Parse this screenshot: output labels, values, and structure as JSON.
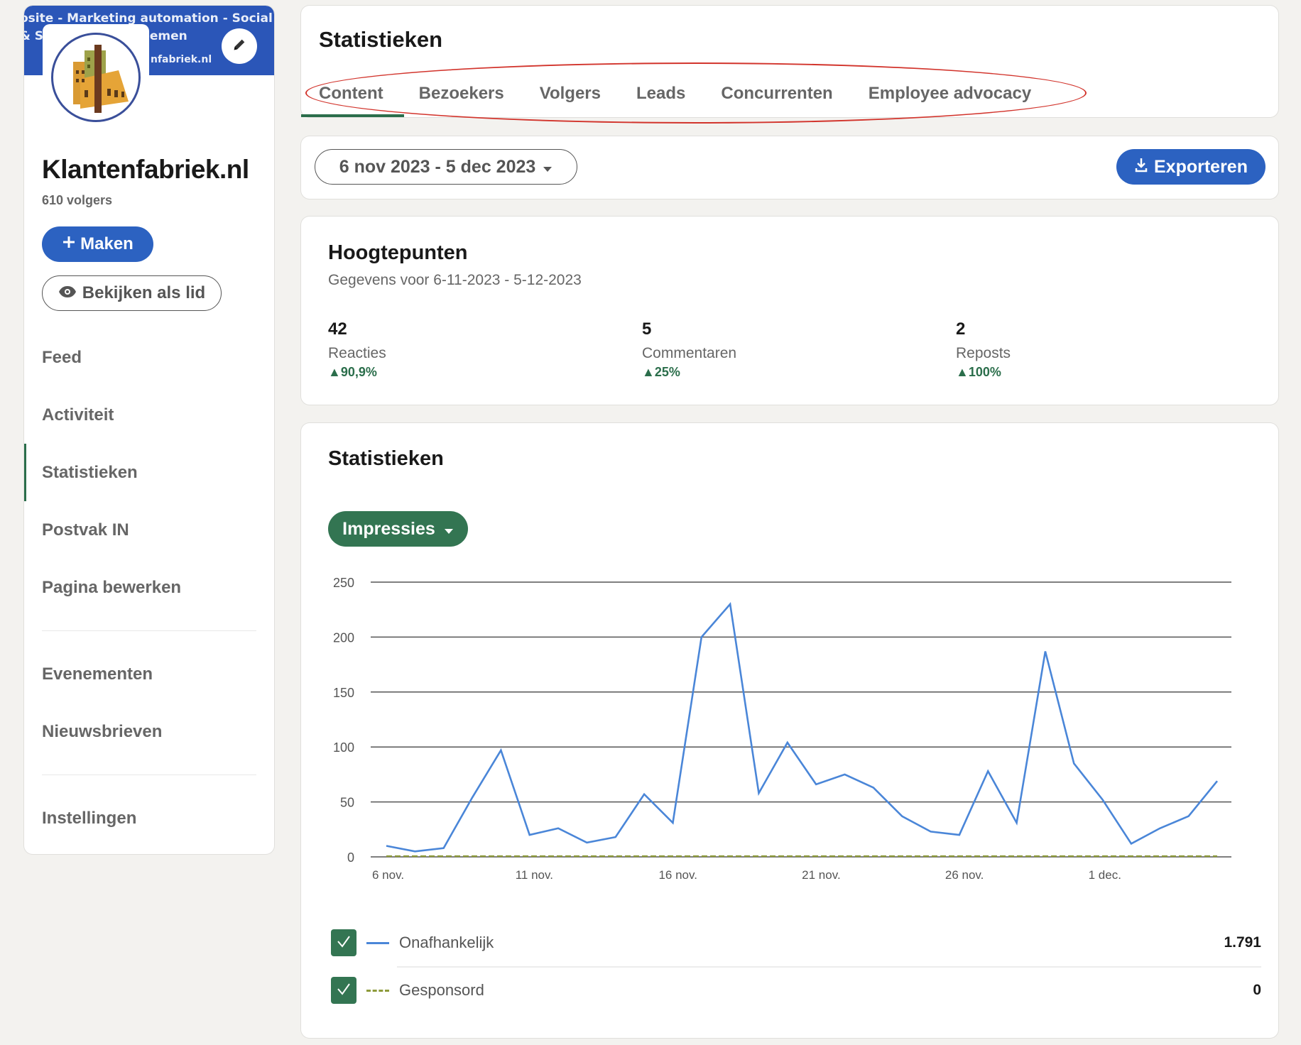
{
  "sidebar": {
    "banner_lines": [
      "osite - Marketing automation - Social med",
      "& S              rukwerk - Evenemen",
      "nfabriek.nl"
    ],
    "org_name": "Klantenfabriek.nl",
    "followers": "610 volgers",
    "make_label": "Maken",
    "view_as_member_label": "Bekijken als lid",
    "nav_primary": [
      {
        "label": "Feed",
        "active": false
      },
      {
        "label": "Activiteit",
        "active": false
      },
      {
        "label": "Statistieken",
        "active": true
      },
      {
        "label": "Postvak IN",
        "active": false
      },
      {
        "label": "Pagina bewerken",
        "active": false
      }
    ],
    "nav_secondary": [
      {
        "label": "Evenementen"
      },
      {
        "label": "Nieuwsbrieven"
      }
    ],
    "nav_tertiary": [
      {
        "label": "Instellingen"
      }
    ]
  },
  "header": {
    "title": "Statistieken",
    "tabs": [
      {
        "label": "Content",
        "active": true
      },
      {
        "label": "Bezoekers",
        "active": false
      },
      {
        "label": "Volgers",
        "active": false
      },
      {
        "label": "Leads",
        "active": false
      },
      {
        "label": "Concurrenten",
        "active": false
      },
      {
        "label": "Employee advocacy",
        "active": false
      }
    ]
  },
  "toolbar": {
    "date_range": "6 nov 2023 - 5 dec 2023",
    "export_label": "Exporteren"
  },
  "highlights": {
    "title": "Hoogtepunten",
    "subtitle": "Gegevens voor 6-11-2023 - 5-12-2023",
    "metrics": [
      {
        "value": "42",
        "label": "Reacties",
        "change": "90,9%"
      },
      {
        "value": "5",
        "label": "Commentaren",
        "change": "25%"
      },
      {
        "value": "2",
        "label": "Reposts",
        "change": "100%"
      }
    ]
  },
  "stats": {
    "title": "Statistieken",
    "metric_selected": "Impressies"
  },
  "colors": {
    "brand_blue": "#2c62c1",
    "brand_green": "#337552",
    "active_green": "#2b6e4b",
    "series_organic": "#4a86d8",
    "series_sponsored": "#8d9a3a",
    "annotation_red": "#d2342c"
  },
  "chart_data": {
    "type": "line",
    "title": "Statistieken",
    "xlabel": "",
    "ylabel": "",
    "ylim": [
      0,
      250
    ],
    "yticks": [
      0,
      50,
      100,
      150,
      200,
      250
    ],
    "grid": true,
    "x": [
      "6 nov.",
      "7 nov.",
      "8 nov.",
      "9 nov.",
      "10 nov.",
      "11 nov.",
      "12 nov.",
      "13 nov.",
      "14 nov.",
      "15 nov.",
      "16 nov.",
      "17 nov.",
      "18 nov.",
      "19 nov.",
      "20 nov.",
      "21 nov.",
      "22 nov.",
      "23 nov.",
      "24 nov.",
      "25 nov.",
      "26 nov.",
      "27 nov.",
      "28 nov.",
      "29 nov.",
      "30 nov.",
      "1 dec.",
      "2 dec.",
      "3 dec.",
      "4 dec.",
      "5 dec."
    ],
    "xtick_labels": [
      "6 nov.",
      "11 nov.",
      "16 nov.",
      "21 nov.",
      "26 nov.",
      "1 dec."
    ],
    "xtick_indices": [
      0,
      5,
      10,
      15,
      20,
      25
    ],
    "series": [
      {
        "name": "Onafhankelijk",
        "style": "solid",
        "checked": true,
        "total": "1.791",
        "values": [
          10,
          5,
          8,
          54,
          97,
          20,
          26,
          13,
          18,
          57,
          31,
          200,
          230,
          58,
          104,
          66,
          75,
          63,
          37,
          23,
          20,
          78,
          31,
          187,
          85,
          52,
          12,
          26,
          37,
          69
        ]
      },
      {
        "name": "Gesponsord",
        "style": "dashed",
        "checked": true,
        "total": "0",
        "values": [
          0,
          0,
          0,
          0,
          0,
          0,
          0,
          0,
          0,
          0,
          0,
          0,
          0,
          0,
          0,
          0,
          0,
          0,
          0,
          0,
          0,
          0,
          0,
          0,
          0,
          0,
          0,
          0,
          0,
          0
        ]
      }
    ],
    "legend": "bottom"
  }
}
